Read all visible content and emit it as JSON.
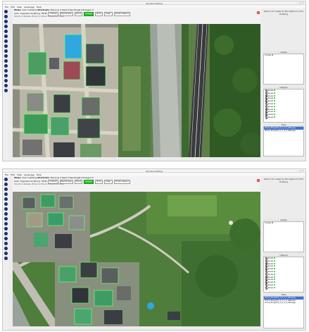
{
  "app": {
    "title": "Semiannotating"
  },
  "colors": {
    "label_dot": "#3fb33f",
    "create_active": "#28c228",
    "close_red": "#e03a3a",
    "file_selected": "#3b74d6",
    "tool_icon": "#1f2f72"
  },
  "menu": [
    "File",
    "Edit",
    "View",
    "Language",
    "Help"
  ],
  "side": {
    "hint": "Search for Label by Box Name to Find Existing"
  },
  "windows": [
    {
      "info": {
        "mode_label": "Mode:",
        "mode_value": "Auto Labeling",
        "shortcuts_label": "Shortcuts:",
        "shortcuts_value": "Previous  A  Next  D  Rectangle  R  Polygon  P",
        "auto_label": "Auto: Segment Anything, HITM",
        "chips": [
          "Output",
          "Rectangle",
          "Point",
          "Create",
          "Hide",
          "Clear",
          "Finish Object"
        ],
        "hint": "Shortcut Delete, Enter to finish, Ctrl+Z to Undo"
      },
      "labels_title": "Labels",
      "labels": [
        {
          "name": "house"
        }
      ],
      "objects_title": "Objects",
      "objects": [
        {
          "name": "house"
        },
        {
          "name": "house"
        },
        {
          "name": "house"
        },
        {
          "name": "house"
        },
        {
          "name": "house"
        },
        {
          "name": "house"
        },
        {
          "name": "house"
        },
        {
          "name": "house"
        },
        {
          "name": "house"
        },
        {
          "name": "house"
        },
        {
          "name": "house"
        }
      ],
      "files_title": "Files",
      "files": [
        "drone_fimg(13)_2_1_1_2_data.jpg",
        "drone_fimg(13)_2_1_2_0_data.jpg"
      ]
    },
    {
      "info": {
        "mode_label": "Mode:",
        "mode_value": "Auto Labeling",
        "shortcuts_label": "Shortcuts:",
        "shortcuts_value": "Previous  A  Next  D  Rectangle  R  Polygon  P",
        "auto_label": "Auto: Segment Anything, HITM",
        "chips": [
          "Output",
          "Rectangle",
          "Point",
          "Create",
          "Hide",
          "Clear",
          "Finish Object"
        ],
        "hint": "Shortcut Delete, Enter to finish, Ctrl+Z to Undo"
      },
      "labels_title": "Labels",
      "labels": [
        {
          "name": "house"
        }
      ],
      "objects_title": "Objects",
      "objects": [
        {
          "name": "house"
        },
        {
          "name": "house"
        },
        {
          "name": "house"
        },
        {
          "name": "house"
        },
        {
          "name": "house"
        },
        {
          "name": "house"
        },
        {
          "name": "house"
        },
        {
          "name": "house"
        },
        {
          "name": "house"
        },
        {
          "name": "house"
        },
        {
          "name": "house"
        },
        {
          "name": "house"
        }
      ],
      "files_title": "Files",
      "files": [
        "drone_fimg(13)_3_2_1_1_data.jpg",
        "drone_fimg(13)_3_2_1_2_data.jpg",
        "drone_fimg(13)_3_2_2_0_data.jpg"
      ]
    }
  ]
}
